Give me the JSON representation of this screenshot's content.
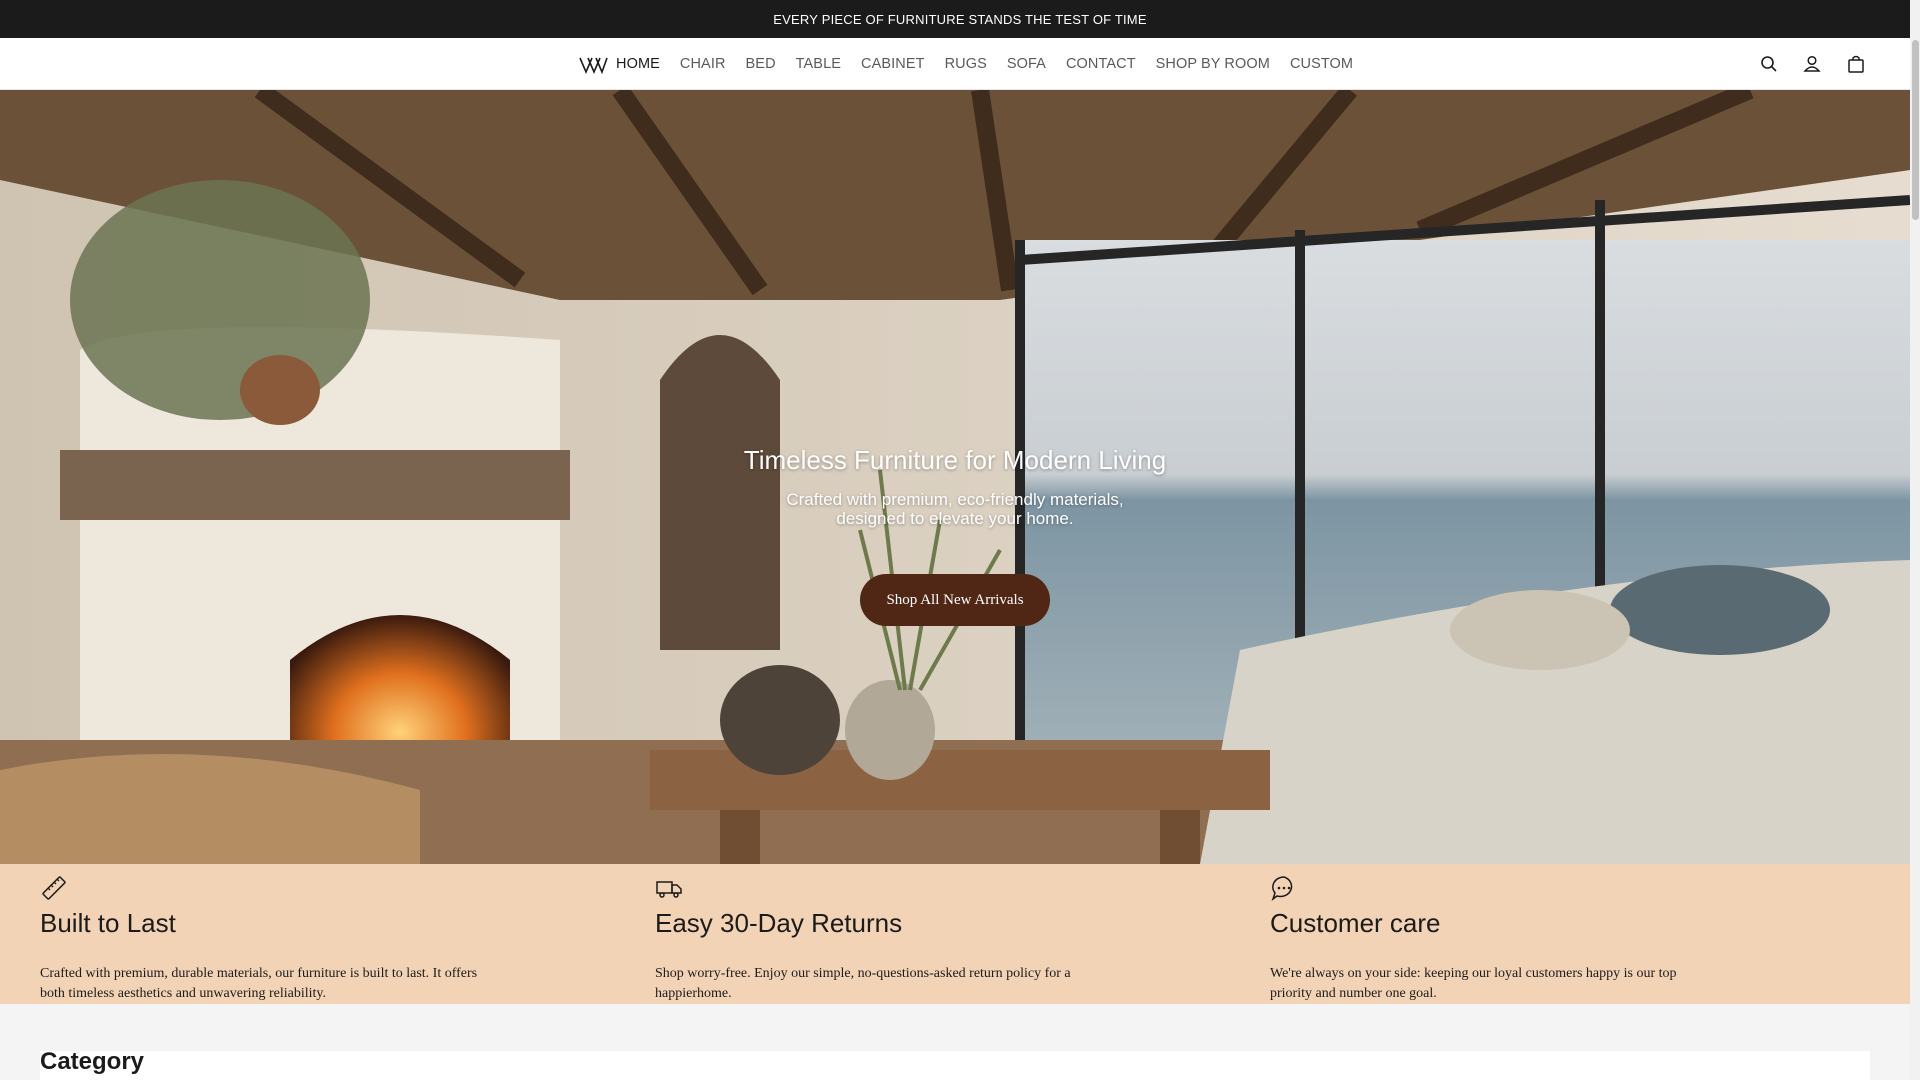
{
  "announcement": "EVERY PIECE OF FURNITURE STANDS THE TEST OF TIME",
  "nav": {
    "items": [
      "HOME",
      "CHAIR",
      "BED",
      "TABLE",
      "CABINET",
      "RUGS",
      "SOFA",
      "CONTACT",
      "SHOP BY ROOM",
      "CUSTOM"
    ],
    "active": "HOME",
    "icons": [
      "search-icon",
      "account-icon",
      "cart-icon"
    ]
  },
  "hero": {
    "title": "Timeless Furniture for Modern Living",
    "subtitle": "Crafted with premium, eco-friendly materials, designed to elevate your home.",
    "button_label": "Shop All New Arrivals"
  },
  "features": [
    {
      "icon": "ruler-icon",
      "title": "Built to Last",
      "text": "Crafted with premium, durable materials, our furniture is built to last. It offers both timeless aesthetics and unwavering reliability."
    },
    {
      "icon": "truck-icon",
      "title": "Easy 30-Day Returns",
      "text": "Shop worry-free. Enjoy our simple, no-questions-asked return policy for a happierhome."
    },
    {
      "icon": "chat-icon",
      "title": "Customer care",
      "text": "We're always on your side: keeping our loyal customers happy is our top priority and number one goal."
    }
  ],
  "category": {
    "title": "Category"
  },
  "colors": {
    "announcement_bg": "#1b1b1b",
    "button_bg": "#4f2714",
    "features_bg": "#f3d3b6"
  }
}
